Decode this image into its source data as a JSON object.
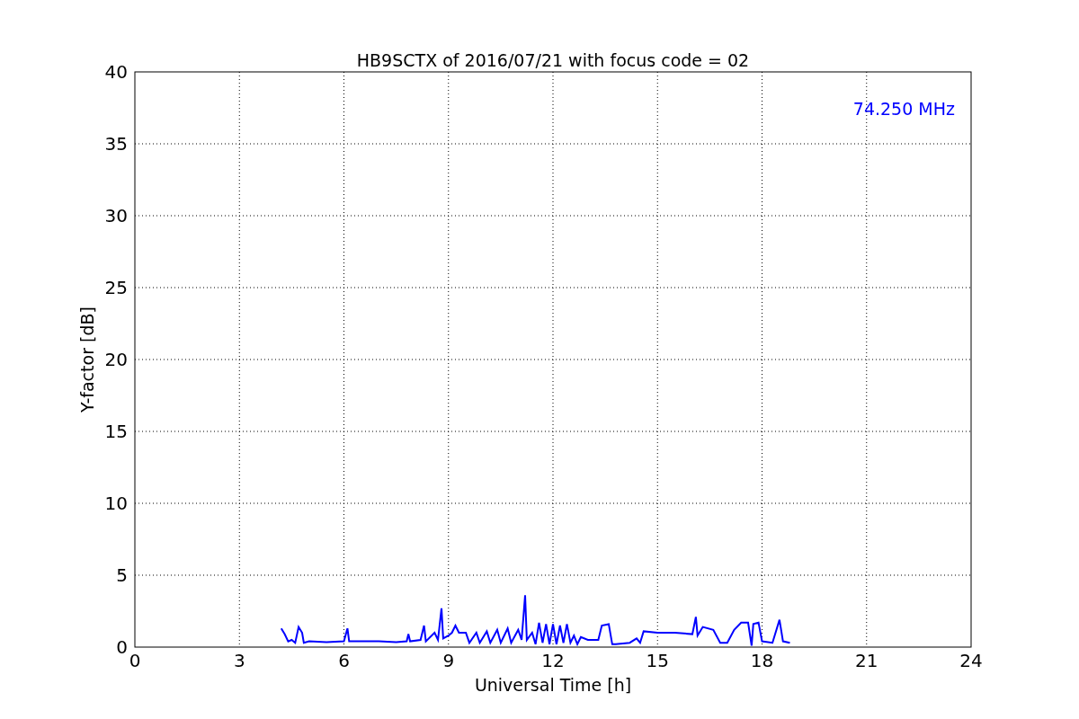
{
  "chart": {
    "chart_data": {
      "type": "line",
      "title": "HB9SCTX of 2016/07/21 with focus code = 02",
      "xlabel": "Universal Time [h]",
      "ylabel": "Y-factor [dB]",
      "x": [
        4.2,
        4.3,
        4.4,
        4.5,
        4.6,
        4.7,
        4.8,
        4.85,
        5.0,
        5.5,
        6.0,
        6.1,
        6.15,
        7.0,
        7.5,
        7.8,
        7.85,
        7.9,
        8.2,
        8.3,
        8.35,
        8.6,
        8.7,
        8.8,
        8.85,
        9.0,
        9.1,
        9.2,
        9.3,
        9.5,
        9.6,
        9.8,
        9.9,
        10.1,
        10.2,
        10.4,
        10.5,
        10.7,
        10.8,
        11.0,
        11.1,
        11.2,
        11.25,
        11.4,
        11.5,
        11.6,
        11.7,
        11.8,
        11.9,
        12.0,
        12.1,
        12.2,
        12.3,
        12.4,
        12.5,
        12.6,
        12.7,
        12.8,
        13.0,
        13.3,
        13.4,
        13.6,
        13.7,
        13.8,
        14.2,
        14.4,
        14.5,
        14.6,
        15.0,
        15.5,
        16.0,
        16.1,
        16.15,
        16.3,
        16.6,
        16.8,
        17.0,
        17.2,
        17.4,
        17.6,
        17.7,
        17.75,
        17.9,
        18.0,
        18.3,
        18.5,
        18.6,
        18.8
      ],
      "series": [
        {
          "name": "74.250 MHz",
          "color": "#0000ff",
          "values": [
            1.3,
            0.9,
            0.4,
            0.5,
            0.3,
            1.4,
            1.0,
            0.3,
            0.4,
            0.35,
            0.4,
            1.3,
            0.4,
            0.4,
            0.35,
            0.4,
            0.9,
            0.4,
            0.5,
            1.5,
            0.4,
            1.0,
            0.5,
            2.7,
            0.6,
            0.8,
            1.0,
            1.5,
            1.0,
            1.0,
            0.3,
            1.0,
            0.3,
            1.1,
            0.3,
            1.2,
            0.3,
            1.3,
            0.3,
            1.2,
            0.5,
            3.6,
            0.5,
            1.0,
            0.2,
            1.7,
            0.3,
            1.6,
            0.2,
            1.6,
            0.2,
            1.5,
            0.3,
            1.6,
            0.3,
            0.8,
            0.2,
            0.7,
            0.5,
            0.5,
            1.5,
            1.6,
            0.2,
            0.2,
            0.3,
            0.6,
            0.3,
            1.1,
            1.0,
            1.0,
            0.9,
            2.1,
            0.8,
            1.4,
            1.2,
            0.3,
            0.3,
            1.2,
            1.7,
            1.7,
            0.1,
            1.6,
            1.7,
            0.4,
            0.3,
            1.9,
            0.4,
            0.3
          ]
        }
      ],
      "xlim": [
        0,
        24
      ],
      "ylim": [
        0,
        40
      ],
      "xticks": [
        0,
        3,
        6,
        9,
        12,
        15,
        18,
        21,
        24
      ],
      "yticks": [
        0,
        5,
        10,
        15,
        20,
        25,
        30,
        35,
        40
      ],
      "grid": true
    }
  }
}
